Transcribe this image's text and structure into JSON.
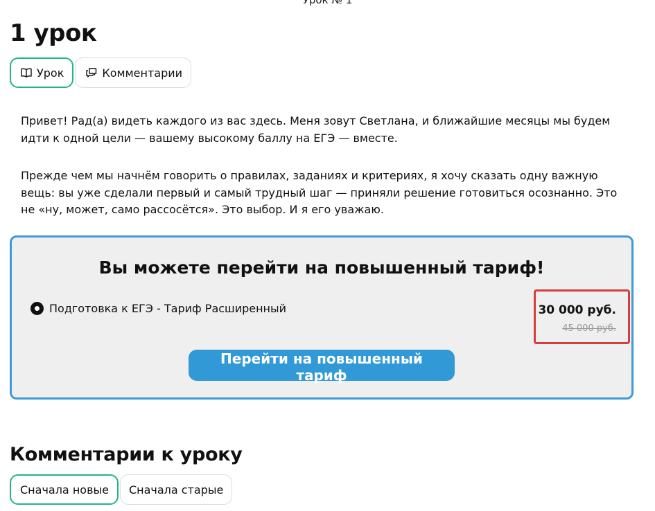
{
  "header": {
    "top_cut_text": "Урок № 1"
  },
  "lesson": {
    "title": "1 урок",
    "tabs": [
      {
        "label": "Урок",
        "icon": "book-icon",
        "active": true
      },
      {
        "label": "Комментарии",
        "icon": "comments-icon",
        "active": false
      }
    ],
    "paragraphs": [
      "Привет! Рад(а) видеть каждого из вас здесь. Меня зовут Светлана, и ближайшие месяцы мы будем идти к одной цели — вашему высокому баллу на ЕГЭ — вместе.",
      "Прежде чем мы начнём говорить о правилах, заданиях и критериях, я хочу сказать одну важную вещь: вы уже сделали первый и самый трудный шаг — приняли решение готовиться осознанно. Это не «ну, может, само рассосётся». Это выбор. И я его уважаю."
    ]
  },
  "upgrade": {
    "title": "Вы можете перейти на повышенный тариф!",
    "tariff_name": "Подготовка к ЕГЭ - Тариф Расширенный",
    "price_new": "30 000 руб.",
    "price_old": "45 000 руб.",
    "button_label": "Перейти на повышенный тариф",
    "accent_color": "#3199d6",
    "highlight_color": "#d93c3c"
  },
  "comments": {
    "title": "Комментарии к уроку",
    "sort_options": [
      {
        "label": "Сначала новые",
        "active": true
      },
      {
        "label": "Сначала старые",
        "active": false
      }
    ]
  }
}
